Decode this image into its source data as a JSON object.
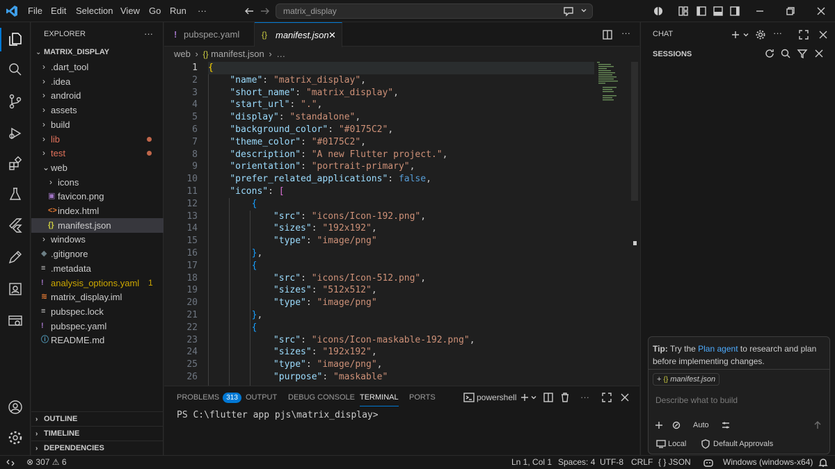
{
  "menu": {
    "file": "File",
    "edit": "Edit",
    "selection": "Selection",
    "view": "View",
    "go": "Go",
    "run": "Run",
    "more": "···"
  },
  "search": {
    "value": "matrix_display"
  },
  "explorer": {
    "title": "EXPLORER",
    "root": "MATRIX_DISPLAY",
    "items": [
      {
        "label": ".dart_tool",
        "color": "#cccccc"
      },
      {
        "label": ".idea",
        "color": "#cccccc"
      },
      {
        "label": "android",
        "color": "#cccccc"
      },
      {
        "label": "assets",
        "color": "#cccccc"
      },
      {
        "label": "build",
        "color": "#cccccc"
      },
      {
        "label": "lib",
        "color": "#e2725b"
      },
      {
        "label": "test",
        "color": "#e2725b"
      },
      {
        "label": "web",
        "color": "#cccccc"
      },
      {
        "label": "icons",
        "color": "#cccccc"
      },
      {
        "label": "favicon.png",
        "color": "#cccccc"
      },
      {
        "label": "index.html",
        "color": "#cccccc"
      },
      {
        "label": "manifest.json",
        "color": "#cccccc"
      },
      {
        "label": "windows",
        "color": "#cccccc"
      },
      {
        "label": ".gitignore",
        "color": "#cccccc"
      },
      {
        "label": ".metadata",
        "color": "#cccccc"
      },
      {
        "label": "analysis_options.yaml",
        "color": "#cca700"
      },
      {
        "label": "matrix_display.iml",
        "color": "#cccccc"
      },
      {
        "label": "pubspec.lock",
        "color": "#cccccc"
      },
      {
        "label": "pubspec.yaml",
        "color": "#cccccc"
      },
      {
        "label": "README.md",
        "color": "#cccccc"
      }
    ],
    "analysis_badge": "1",
    "sections": [
      "OUTLINE",
      "TIMELINE",
      "DEPENDENCIES"
    ]
  },
  "tabs": [
    {
      "label": "pubspec.yaml"
    },
    {
      "label": "manifest.json"
    }
  ],
  "breadcrumb": {
    "folder": "web",
    "sep1": "›",
    "file": "manifest.json",
    "sep2": "›",
    "more": "…"
  },
  "code_lines": [
    "{",
    "    \"name\": \"matrix_display\",",
    "    \"short_name\": \"matrix_display\",",
    "    \"start_url\": \".\",",
    "    \"display\": \"standalone\",",
    "    \"background_color\": \"#0175C2\",",
    "    \"theme_color\": \"#0175C2\",",
    "    \"description\": \"A new Flutter project.\",",
    "    \"orientation\": \"portrait-primary\",",
    "    \"prefer_related_applications\": false,",
    "    \"icons\": [",
    "        {",
    "            \"src\": \"icons/Icon-192.png\",",
    "            \"sizes\": \"192x192\",",
    "            \"type\": \"image/png\"",
    "        },",
    "        {",
    "            \"src\": \"icons/Icon-512.png\",",
    "            \"sizes\": \"512x512\",",
    "            \"type\": \"image/png\"",
    "        },",
    "        {",
    "            \"src\": \"icons/Icon-maskable-192.png\",",
    "            \"sizes\": \"192x192\",",
    "            \"type\": \"image/png\",",
    "            \"purpose\": \"maskable\""
  ],
  "panel": {
    "problems": "PROBLEMS",
    "problems_count": "313",
    "output": "OUTPUT",
    "debug": "DEBUG CONSOLE",
    "terminal": "TERMINAL",
    "ports": "PORTS",
    "shell": "powershell",
    "prompt": "PS C:\\flutter app pjs\\matrix_display>"
  },
  "chat": {
    "title": "CHAT",
    "sessions": "SESSIONS",
    "tip_bold": "Tip:",
    "tip_pre": " Try the ",
    "tip_link": "Plan agent",
    "tip_post": " to research and plan before implementing changes.",
    "context_file": "manifest.json",
    "placeholder": "Describe what to build",
    "mode": "Auto",
    "local": "Local",
    "approvals": "Default Approvals"
  },
  "status": {
    "errors": "307",
    "warnings": "6",
    "position": "Ln 1, Col 1",
    "spaces": "Spaces: 4",
    "encoding": "UTF-8",
    "eol": "CRLF",
    "language": "{ } JSON",
    "platform": "Windows (windows-x64)"
  },
  "colors": {
    "accent": "#0078d4",
    "json_key": "#9cdcfe",
    "json_string": "#ce9178",
    "json_bool": "#569cd6",
    "warning": "#cca700",
    "git_modified": "#e2725b"
  }
}
